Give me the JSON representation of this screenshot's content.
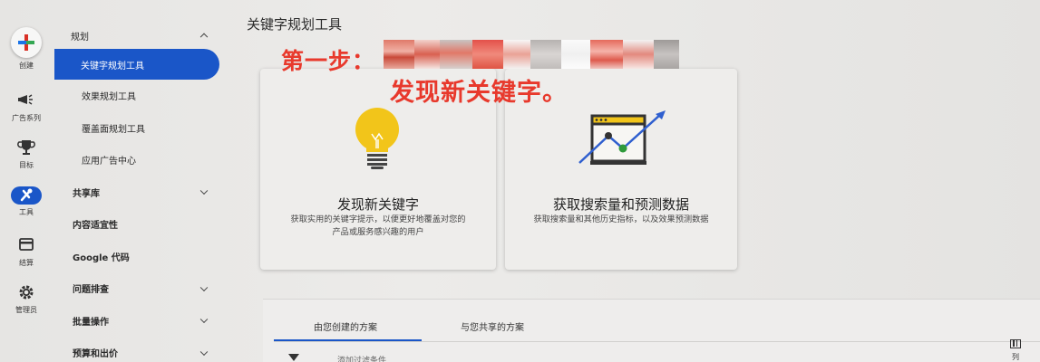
{
  "rail": {
    "items": [
      {
        "label": "创建",
        "icon": "plus-icon"
      },
      {
        "label": "广告系列",
        "icon": "megaphone-icon"
      },
      {
        "label": "目标",
        "icon": "trophy-icon"
      },
      {
        "label": "工具",
        "icon": "wrench-icon"
      },
      {
        "label": "结算",
        "icon": "credit-card-icon"
      },
      {
        "label": "管理员",
        "icon": "gear-icon"
      }
    ]
  },
  "sidenav": {
    "items": [
      {
        "label": "规划",
        "expanded": true
      },
      {
        "label": "关键字规划工具",
        "active": true
      },
      {
        "label": "效果规划工具"
      },
      {
        "label": "覆盖面规划工具"
      },
      {
        "label": "应用广告中心"
      },
      {
        "label": "共享库",
        "collapsed": true
      },
      {
        "label": "内容适宜性"
      },
      {
        "label": "Google 代码"
      },
      {
        "label": "问题排查",
        "collapsed": true
      },
      {
        "label": "批量操作",
        "collapsed": true
      },
      {
        "label": "预算和出价",
        "collapsed": true
      }
    ]
  },
  "header": {
    "title": "关键字规划工具"
  },
  "annotation": {
    "step": "第一步：",
    "subtitle": "发现新关键字。"
  },
  "cards": [
    {
      "title": "发现新关键字",
      "desc_line1": "获取实用的关键字提示，以便更好地覆盖对您的",
      "desc_line2": "产品或服务感兴趣的用户",
      "icon": "lightbulb-icon"
    },
    {
      "title": "获取搜索量和预测数据",
      "desc_line1": "获取搜索量和其他历史指标，以及效果预测数据",
      "icon": "trend-chart-icon"
    }
  ],
  "panel": {
    "tabs": [
      {
        "label": "由您创建的方案",
        "active": true
      },
      {
        "label": "与您共享的方案"
      }
    ],
    "filter_text": "添加过滤条件",
    "columns_label": "列"
  },
  "colors": {
    "accent": "#1a56c8",
    "annotation_red": "#e8392c",
    "background": "#e9e8e6"
  }
}
